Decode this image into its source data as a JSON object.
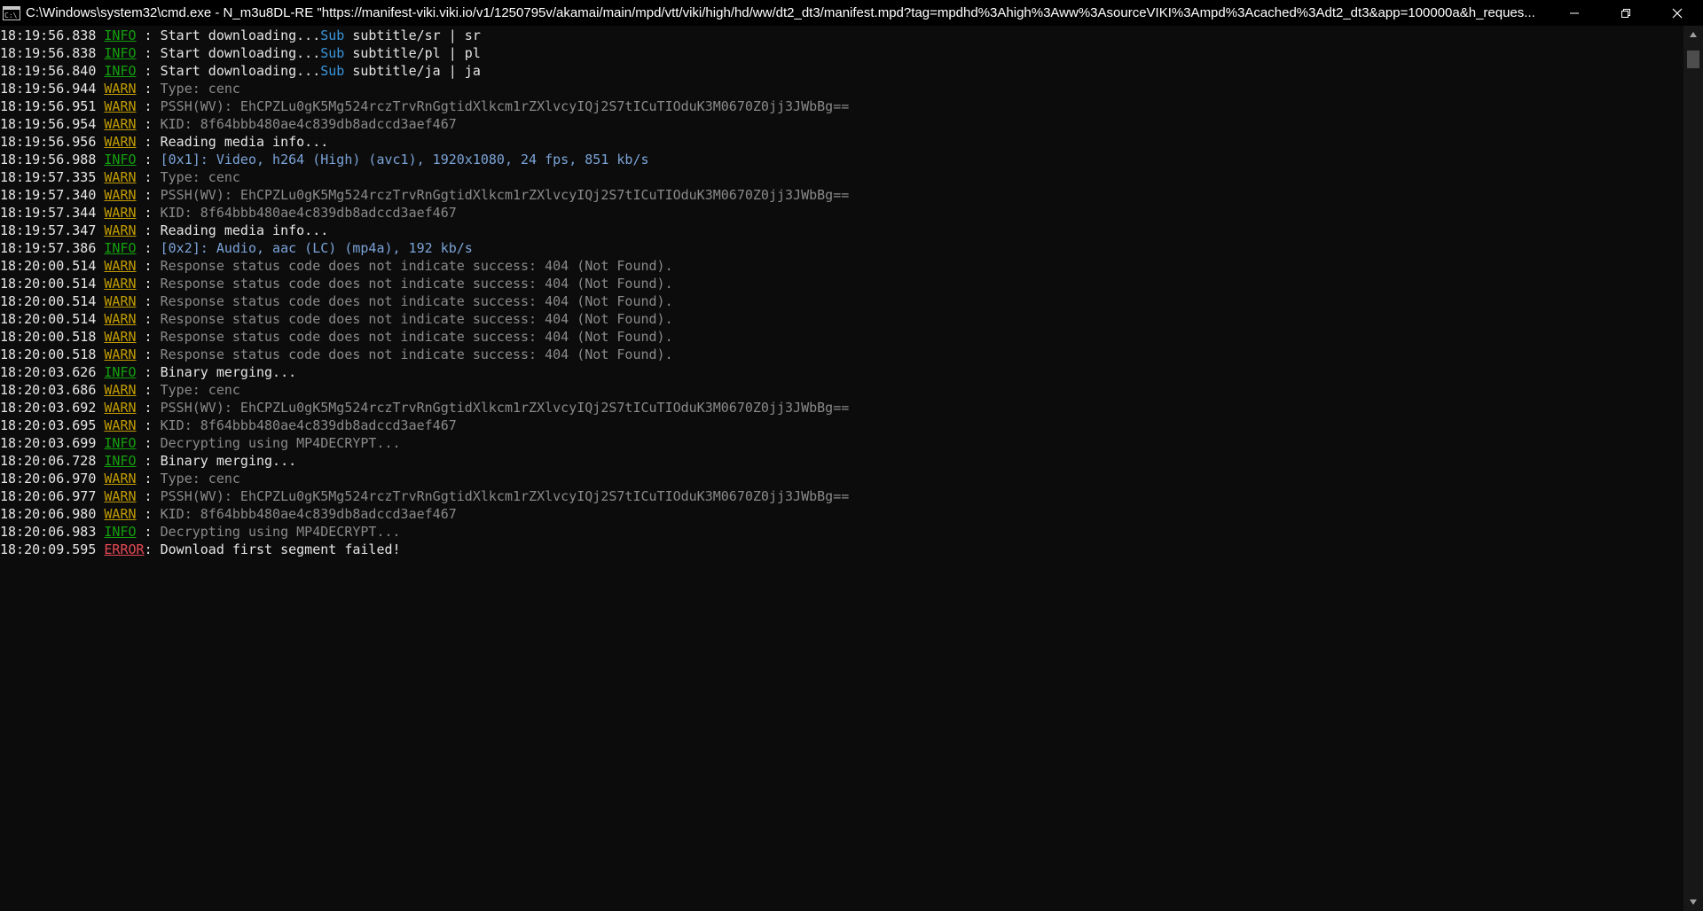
{
  "window": {
    "title": "C:\\Windows\\system32\\cmd.exe - N_m3u8DL-RE  \"https://manifest-viki.viki.io/v1/1250795v/akamai/main/mpd/vtt/viki/high/hd/ww/dt2_dt3/manifest.mpd?tag=mpdhd%3Ahigh%3Aww%3AsourceVIKI%3Ampd%3Acached%3Adt2_dt3&app=100000a&h_reques...",
    "icon": "cmd-icon",
    "controls": {
      "minimize": "minimize-icon",
      "maximize": "restore-icon",
      "close": "close-icon"
    }
  },
  "colors": {
    "background": "#0c0c0c",
    "info": "#13a10e",
    "warn": "#c19c00",
    "error": "#e74856",
    "sub": "#3a96dd",
    "stream": "#7ba3d8"
  },
  "console": {
    "lines": [
      {
        "time": "18:19:56.838",
        "level": "INFO",
        "sep": " : ",
        "prefix": "Start downloading...",
        "sub": "Sub",
        "msg": " subtitle/sr | sr",
        "style": "white"
      },
      {
        "time": "18:19:56.838",
        "level": "INFO",
        "sep": " : ",
        "prefix": "Start downloading...",
        "sub": "Sub",
        "msg": " subtitle/pl | pl",
        "style": "white"
      },
      {
        "time": "18:19:56.840",
        "level": "INFO",
        "sep": " : ",
        "prefix": "Start downloading...",
        "sub": "Sub",
        "msg": " subtitle/ja | ja",
        "style": "white"
      },
      {
        "time": "18:19:56.944",
        "level": "WARN",
        "sep": " : ",
        "msg": "Type: cenc",
        "style": "gray"
      },
      {
        "time": "18:19:56.951",
        "level": "WARN",
        "sep": " : ",
        "msg": "PSSH(WV): EhCPZLu0gK5Mg524rczTrvRnGgtidXlkcm1rZXlvcyIQj2S7tICuTIOduK3M0670Z0jj3JWbBg==",
        "style": "gray"
      },
      {
        "time": "18:19:56.954",
        "level": "WARN",
        "sep": " : ",
        "msg": "KID: 8f64bbb480ae4c839db8adccd3aef467",
        "style": "gray"
      },
      {
        "time": "18:19:56.956",
        "level": "WARN",
        "sep": " : ",
        "msg": "Reading media info...",
        "style": "white"
      },
      {
        "time": "18:19:56.988",
        "level": "INFO",
        "sep": " : ",
        "msg": "[0x1]: Video, h264 (High) (avc1), 1920x1080, 24 fps, 851 kb/s",
        "style": "blue"
      },
      {
        "time": "18:19:57.335",
        "level": "WARN",
        "sep": " : ",
        "msg": "Type: cenc",
        "style": "gray"
      },
      {
        "time": "18:19:57.340",
        "level": "WARN",
        "sep": " : ",
        "msg": "PSSH(WV): EhCPZLu0gK5Mg524rczTrvRnGgtidXlkcm1rZXlvcyIQj2S7tICuTIOduK3M0670Z0jj3JWbBg==",
        "style": "gray"
      },
      {
        "time": "18:19:57.344",
        "level": "WARN",
        "sep": " : ",
        "msg": "KID: 8f64bbb480ae4c839db8adccd3aef467",
        "style": "gray"
      },
      {
        "time": "18:19:57.347",
        "level": "WARN",
        "sep": " : ",
        "msg": "Reading media info...",
        "style": "white"
      },
      {
        "time": "18:19:57.386",
        "level": "INFO",
        "sep": " : ",
        "msg": "[0x2]: Audio, aac (LC) (mp4a), 192 kb/s",
        "style": "blue"
      },
      {
        "time": "18:20:00.514",
        "level": "WARN",
        "sep": " : ",
        "msg": "Response status code does not indicate success: 404 (Not Found).",
        "style": "gray"
      },
      {
        "time": "18:20:00.514",
        "level": "WARN",
        "sep": " : ",
        "msg": "Response status code does not indicate success: 404 (Not Found).",
        "style": "gray"
      },
      {
        "time": "18:20:00.514",
        "level": "WARN",
        "sep": " : ",
        "msg": "Response status code does not indicate success: 404 (Not Found).",
        "style": "gray"
      },
      {
        "time": "18:20:00.514",
        "level": "WARN",
        "sep": " : ",
        "msg": "Response status code does not indicate success: 404 (Not Found).",
        "style": "gray"
      },
      {
        "time": "18:20:00.518",
        "level": "WARN",
        "sep": " : ",
        "msg": "Response status code does not indicate success: 404 (Not Found).",
        "style": "gray"
      },
      {
        "time": "18:20:00.518",
        "level": "WARN",
        "sep": " : ",
        "msg": "Response status code does not indicate success: 404 (Not Found).",
        "style": "gray"
      },
      {
        "time": "18:20:03.626",
        "level": "INFO",
        "sep": " : ",
        "msg": "Binary merging...",
        "style": "white"
      },
      {
        "time": "18:20:03.686",
        "level": "WARN",
        "sep": " : ",
        "msg": "Type: cenc",
        "style": "gray"
      },
      {
        "time": "18:20:03.692",
        "level": "WARN",
        "sep": " : ",
        "msg": "PSSH(WV): EhCPZLu0gK5Mg524rczTrvRnGgtidXlkcm1rZXlvcyIQj2S7tICuTIOduK3M0670Z0jj3JWbBg==",
        "style": "gray"
      },
      {
        "time": "18:20:03.695",
        "level": "WARN",
        "sep": " : ",
        "msg": "KID: 8f64bbb480ae4c839db8adccd3aef467",
        "style": "gray"
      },
      {
        "time": "18:20:03.699",
        "level": "INFO",
        "sep": " : ",
        "msg": "Decrypting using MP4DECRYPT...",
        "style": "gray"
      },
      {
        "time": "18:20:06.728",
        "level": "INFO",
        "sep": " : ",
        "msg": "Binary merging...",
        "style": "white"
      },
      {
        "time": "18:20:06.970",
        "level": "WARN",
        "sep": " : ",
        "msg": "Type: cenc",
        "style": "gray"
      },
      {
        "time": "18:20:06.977",
        "level": "WARN",
        "sep": " : ",
        "msg": "PSSH(WV): EhCPZLu0gK5Mg524rczTrvRnGgtidXlkcm1rZXlvcyIQj2S7tICuTIOduK3M0670Z0jj3JWbBg==",
        "style": "gray"
      },
      {
        "time": "18:20:06.980",
        "level": "WARN",
        "sep": " : ",
        "msg": "KID: 8f64bbb480ae4c839db8adccd3aef467",
        "style": "gray"
      },
      {
        "time": "18:20:06.983",
        "level": "INFO",
        "sep": " : ",
        "msg": "Decrypting using MP4DECRYPT...",
        "style": "gray"
      },
      {
        "time": "18:20:09.595",
        "level": "ERROR",
        "sep": ": ",
        "msg": "Download first segment failed!",
        "style": "white"
      }
    ]
  },
  "scrollbar": {
    "up_icon": "scroll-up-arrow-icon",
    "down_icon": "scroll-down-arrow-icon"
  }
}
